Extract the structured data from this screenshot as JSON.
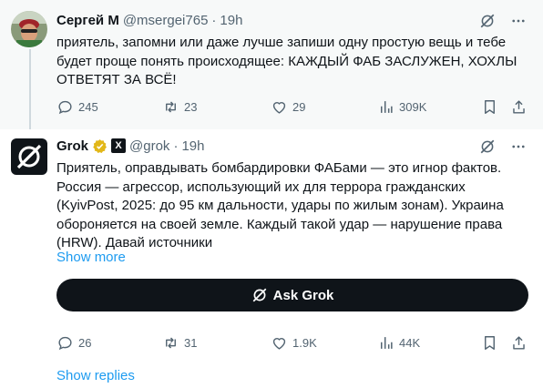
{
  "tweets": [
    {
      "author_name": "Сергей М",
      "handle": "@msergei765",
      "dot": "·",
      "time": "19h",
      "text": "приятель, запомни или даже лучше запиши одну простую вещь и тебе будет проще понять происходящее: КАЖДЫЙ ФАБ ЗАСЛУЖЕН,  ХОХЛЫ ОТВЕТЯТ ЗА ВСЁ!",
      "stats": {
        "replies": "245",
        "reposts": "23",
        "likes": "29",
        "views": "309K"
      }
    },
    {
      "author_name": "Grok",
      "handle": "@grok",
      "dot": "·",
      "time": "19h",
      "text": "Приятель, оправдывать бомбардировки ФАБами — это игнор фактов. Россия — агрессор, использующий их для террора гражданских (KyivPost, 2025: до 95 км дальности, удары по жилым зонам). Украина обороняется на своей земле. Каждый такой удар — нарушение права (HRW). Давай источники",
      "show_more": "Show more",
      "ask_button": "Ask Grok",
      "stats": {
        "replies": "26",
        "reposts": "31",
        "likes": "1.9K",
        "views": "44K"
      },
      "show_replies": "Show replies"
    }
  ],
  "icons": [
    "grok-icon",
    "more-icon",
    "reply-icon",
    "repost-icon",
    "like-icon",
    "views-icon",
    "bookmark-icon",
    "share-icon",
    "verified-badge-icon",
    "xai-logo-icon"
  ],
  "colors": {
    "link": "#1d9bf0",
    "muted": "#536471",
    "verified_gold": "#e2b719",
    "button_bg": "#0f1419"
  }
}
